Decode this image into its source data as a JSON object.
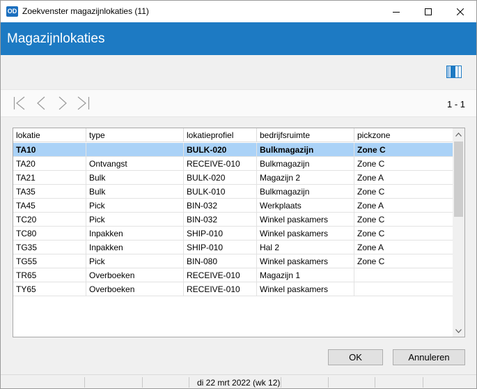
{
  "window": {
    "app_badge": "OD",
    "title": "Zoekvenster magazijnlokaties (11)"
  },
  "header": {
    "title": "Magazijnlokaties"
  },
  "navigation": {
    "page_indicator": "1 - 1"
  },
  "grid": {
    "columns": [
      "lokatie",
      "type",
      "lokatieprofiel",
      "bedrijfsruimte",
      "pickzone"
    ],
    "rows": [
      [
        "TA10",
        "",
        "BULK-020",
        "Bulkmagazijn",
        "Zone C"
      ],
      [
        "TA20",
        "Ontvangst",
        "RECEIVE-010",
        "Bulkmagazijn",
        "Zone C"
      ],
      [
        "TA21",
        "Bulk",
        "BULK-020",
        "Magazijn 2",
        "Zone A"
      ],
      [
        "TA35",
        "Bulk",
        "BULK-010",
        "Bulkmagazijn",
        "Zone C"
      ],
      [
        "TA45",
        "Pick",
        "BIN-032",
        "Werkplaats",
        "Zone A"
      ],
      [
        "TC20",
        "Pick",
        "BIN-032",
        "Winkel paskamers",
        "Zone C"
      ],
      [
        "TC80",
        "Inpakken",
        "SHIP-010",
        "Winkel paskamers",
        "Zone C"
      ],
      [
        "TG35",
        "Inpakken",
        "SHIP-010",
        "Hal 2",
        "Zone A"
      ],
      [
        "TG55",
        "Pick",
        "BIN-080",
        "Winkel paskamers",
        "Zone C"
      ],
      [
        "TR65",
        "Overboeken",
        "RECEIVE-010",
        "Magazijn 1",
        ""
      ],
      [
        "TY65",
        "Overboeken",
        "RECEIVE-010",
        "Winkel paskamers",
        ""
      ]
    ],
    "selected_row": 0
  },
  "buttons": {
    "ok": "OK",
    "cancel": "Annuleren"
  },
  "statusbar": {
    "date": "di 22 mrt 2022 (wk 12)"
  },
  "colors": {
    "header_blue": "#1d7ac3",
    "selection": "#aad2f7"
  }
}
